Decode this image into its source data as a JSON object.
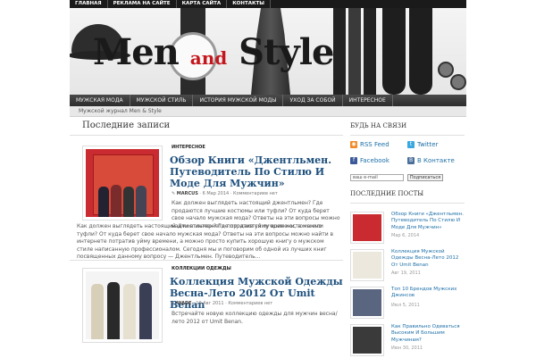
{
  "topbar": {
    "items": [
      "ГЛАВНАЯ",
      "РЕКЛАМА НА САЙТЕ",
      "КАРТА САЙТА",
      "КОНТАКТЫ"
    ]
  },
  "logo": {
    "word1": "Men",
    "word2": "and",
    "word3": "Style"
  },
  "nav": {
    "items": [
      "МУЖСКАЯ МОДА",
      "МУЖСКОЙ СТИЛЬ",
      "ИСТОРИЯ МУЖСКОЙ МОДЫ",
      "УХОД ЗА СОБОЙ",
      "ИНТЕРЕСНОЕ"
    ]
  },
  "subnav": {
    "text": "Мужской журнал Men & Style"
  },
  "main": {
    "section_title": "Последние записи",
    "posts": [
      {
        "category": "ИНТЕРЕСНОЕ",
        "title": "Обзор Книги «Джентльмен. Путеводитель По Стилю И Моде Для Мужчин»",
        "author": "MARCUS",
        "date": "6 Мар 2014",
        "comments": "Комментариев нет",
        "excerpt": "Как должен выглядеть настоящий джентльмен? Где продаются лучшие костюмы или туфли? От куда берет свое начало мужская мода? Ответы на эти вопросы можно найти в интернете потратив уйму времени, а можно просто купить хорошую книгу о мужском стиле написанную профессионалом. Сегодня мы и поговорим об одной из лучших книг посвященных данному вопросу — Джентльмен. Путеводитель..."
      },
      {
        "category": "КОЛЛЕКЦИИ ОДЕЖДЫ",
        "title": "Коллекция Мужской Одежды Весна-Лето 2012 От Umit Benan",
        "author": "WADE",
        "date": "19 Авг 2011",
        "comments": "Комментариев нет",
        "excerpt": "Встречайте новую коллекцию одежды для мужчин весна/лето 2012 от Umit Benan."
      }
    ]
  },
  "sidebar": {
    "connect_title": "БУДЬ НА СВЯЗИ",
    "rss": "RSS Feed",
    "twitter": "Twitter",
    "facebook": "Facebook",
    "vk": "В Контакте",
    "email_placeholder": "ваш e-mail",
    "subscribe": "Подписаться",
    "recent_title": "ПОСЛЕДНИЕ ПОСТЫ",
    "recent": [
      {
        "title": "Обзор Книги «Джентльмен. Путеводитель По Стилю И Моде Для Мужчин»",
        "date": "Мар 6, 2014"
      },
      {
        "title": "Коллекция Мужской Одежды Весна-Лето 2012 От Umit Benan",
        "date": "Авг 19, 2011"
      },
      {
        "title": "Топ 10 Брендов Мужских Джинсов",
        "date": "Июл 5, 2011"
      },
      {
        "title": "Как Правильно Одеваться Высоким И Большим Мужчинам?",
        "date": "Июн 30, 2011"
      }
    ]
  },
  "colors": {
    "accent_red": "#c4171d",
    "link_blue": "#1d4f7c",
    "nav_dark": "#2c2c2c"
  }
}
